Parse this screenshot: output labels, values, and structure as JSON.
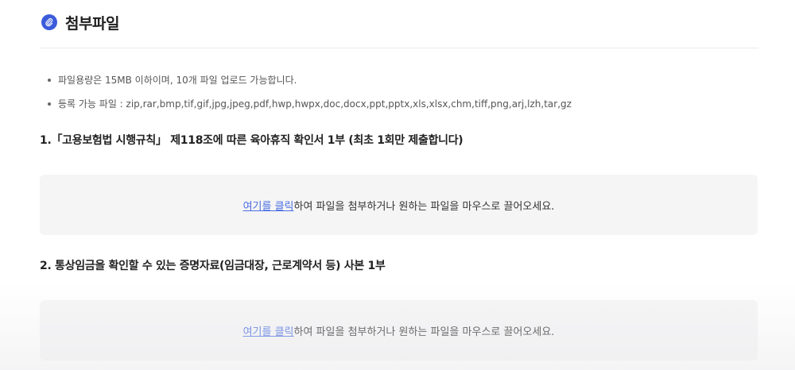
{
  "section": {
    "title": "첨부파일",
    "icon": "clip-icon",
    "accent_color": "#3b5bdb"
  },
  "notes": [
    "파일용량은 15MB 이하이며, 10개 파일 업로드 가능합니다.",
    "등록 가능 파일 : zip,rar,bmp,tif,gif,jpg,jpeg,pdf,hwp,hwpx,doc,docx,ppt,pptx,xls,xlsx,chm,tiff,png,arj,lzh,tar,gz"
  ],
  "attachments": [
    {
      "title": "1.「고용보험법 시행규칙」 제118조에 따른 육아휴직 확인서 1부 (최초 1회만 제출합니다)",
      "dropzone_link": "여기를 클릭",
      "dropzone_text": "하여 파일을 첨부하거나 원하는 파일을 마우스로 끌어오세요."
    },
    {
      "title": "2. 통상임금을 확인할 수 있는 증명자료(임금대장, 근로계약서 등) 사본 1부",
      "dropzone_link": "여기를 클릭",
      "dropzone_text": "하여 파일을 첨부하거나 원하는 파일을 마우스로 끌어오세요."
    }
  ],
  "colors": {
    "link": "#4a6ee0",
    "dropzone_bg": "#f5f5f6"
  }
}
